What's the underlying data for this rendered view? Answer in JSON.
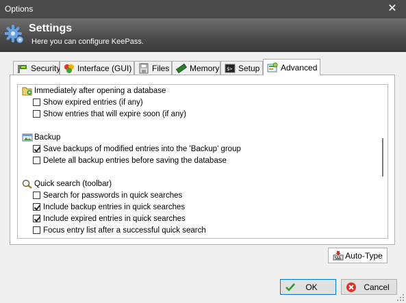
{
  "window": {
    "title": "Options",
    "close_glyph": "✕"
  },
  "banner": {
    "title": "Settings",
    "subtitle": "Here you can configure KeePass."
  },
  "tabs": [
    {
      "label": "Security",
      "icon": "security-icon"
    },
    {
      "label": "Interface (GUI)",
      "icon": "interface-icon"
    },
    {
      "label": "Files",
      "icon": "files-icon"
    },
    {
      "label": "Memory",
      "icon": "memory-icon"
    },
    {
      "label": "Setup",
      "icon": "setup-icon"
    },
    {
      "label": "Advanced",
      "icon": "advanced-icon",
      "active": true
    }
  ],
  "groups": [
    {
      "label": "Immediately after opening a database",
      "icon": "open-database-icon",
      "options": [
        {
          "label": "Show expired entries (if any)",
          "checked": false
        },
        {
          "label": "Show entries that will expire soon (if any)",
          "checked": false
        }
      ]
    },
    {
      "label": "Backup",
      "icon": "backup-icon",
      "options": [
        {
          "label": "Save backups of modified entries into the 'Backup' group",
          "checked": true
        },
        {
          "label": "Delete all backup entries before saving the database",
          "checked": false
        }
      ]
    },
    {
      "label": "Quick search (toolbar)",
      "icon": "quick-search-icon",
      "options": [
        {
          "label": "Search for passwords in quick searches",
          "checked": false
        },
        {
          "label": "Include backup entries in quick searches",
          "checked": true
        },
        {
          "label": "Include expired entries in quick searches",
          "checked": true
        },
        {
          "label": "Focus entry list after a successful quick search",
          "checked": false
        }
      ]
    }
  ],
  "buttons": {
    "auto_type": "Auto-Type",
    "ok": "OK",
    "cancel": "Cancel"
  },
  "colors": {
    "titlebar": "#4a4a4a",
    "banner": "#4c4c4c",
    "ok_border": "#0078d7"
  }
}
